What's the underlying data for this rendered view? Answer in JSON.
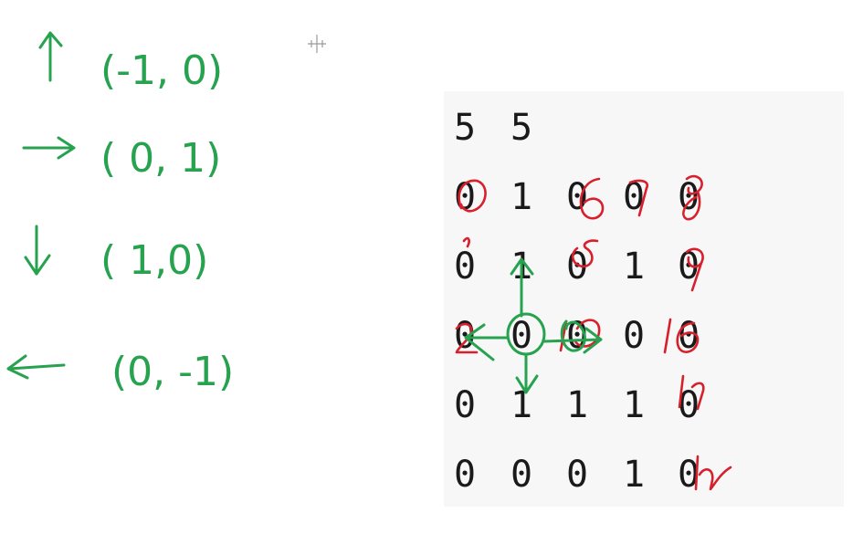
{
  "directions": [
    {
      "label": "(-1, 0)",
      "icon": "up-arrow-icon"
    },
    {
      "label": "( 0, 1)",
      "icon": "right-arrow-icon"
    },
    {
      "label": "( 1,0)",
      "icon": "down-arrow-icon"
    },
    {
      "label": "(0, -1)",
      "icon": "left-arrow-icon"
    }
  ],
  "grid": {
    "header": [
      "5",
      "5"
    ],
    "rows": [
      [
        "0",
        "1",
        "0",
        "0",
        "0"
      ],
      [
        "0",
        "1",
        "0",
        "1",
        "0"
      ],
      [
        "0",
        "0",
        "0",
        "0",
        "0"
      ],
      [
        "0",
        "1",
        "1",
        "1",
        "0"
      ],
      [
        "0",
        "0",
        "0",
        "1",
        "0"
      ]
    ]
  },
  "colors": {
    "green_ink": "#27a24f",
    "red_ink": "#d8202c",
    "grid_background": "#f7f7f7",
    "grid_text": "#1a1a1a"
  }
}
